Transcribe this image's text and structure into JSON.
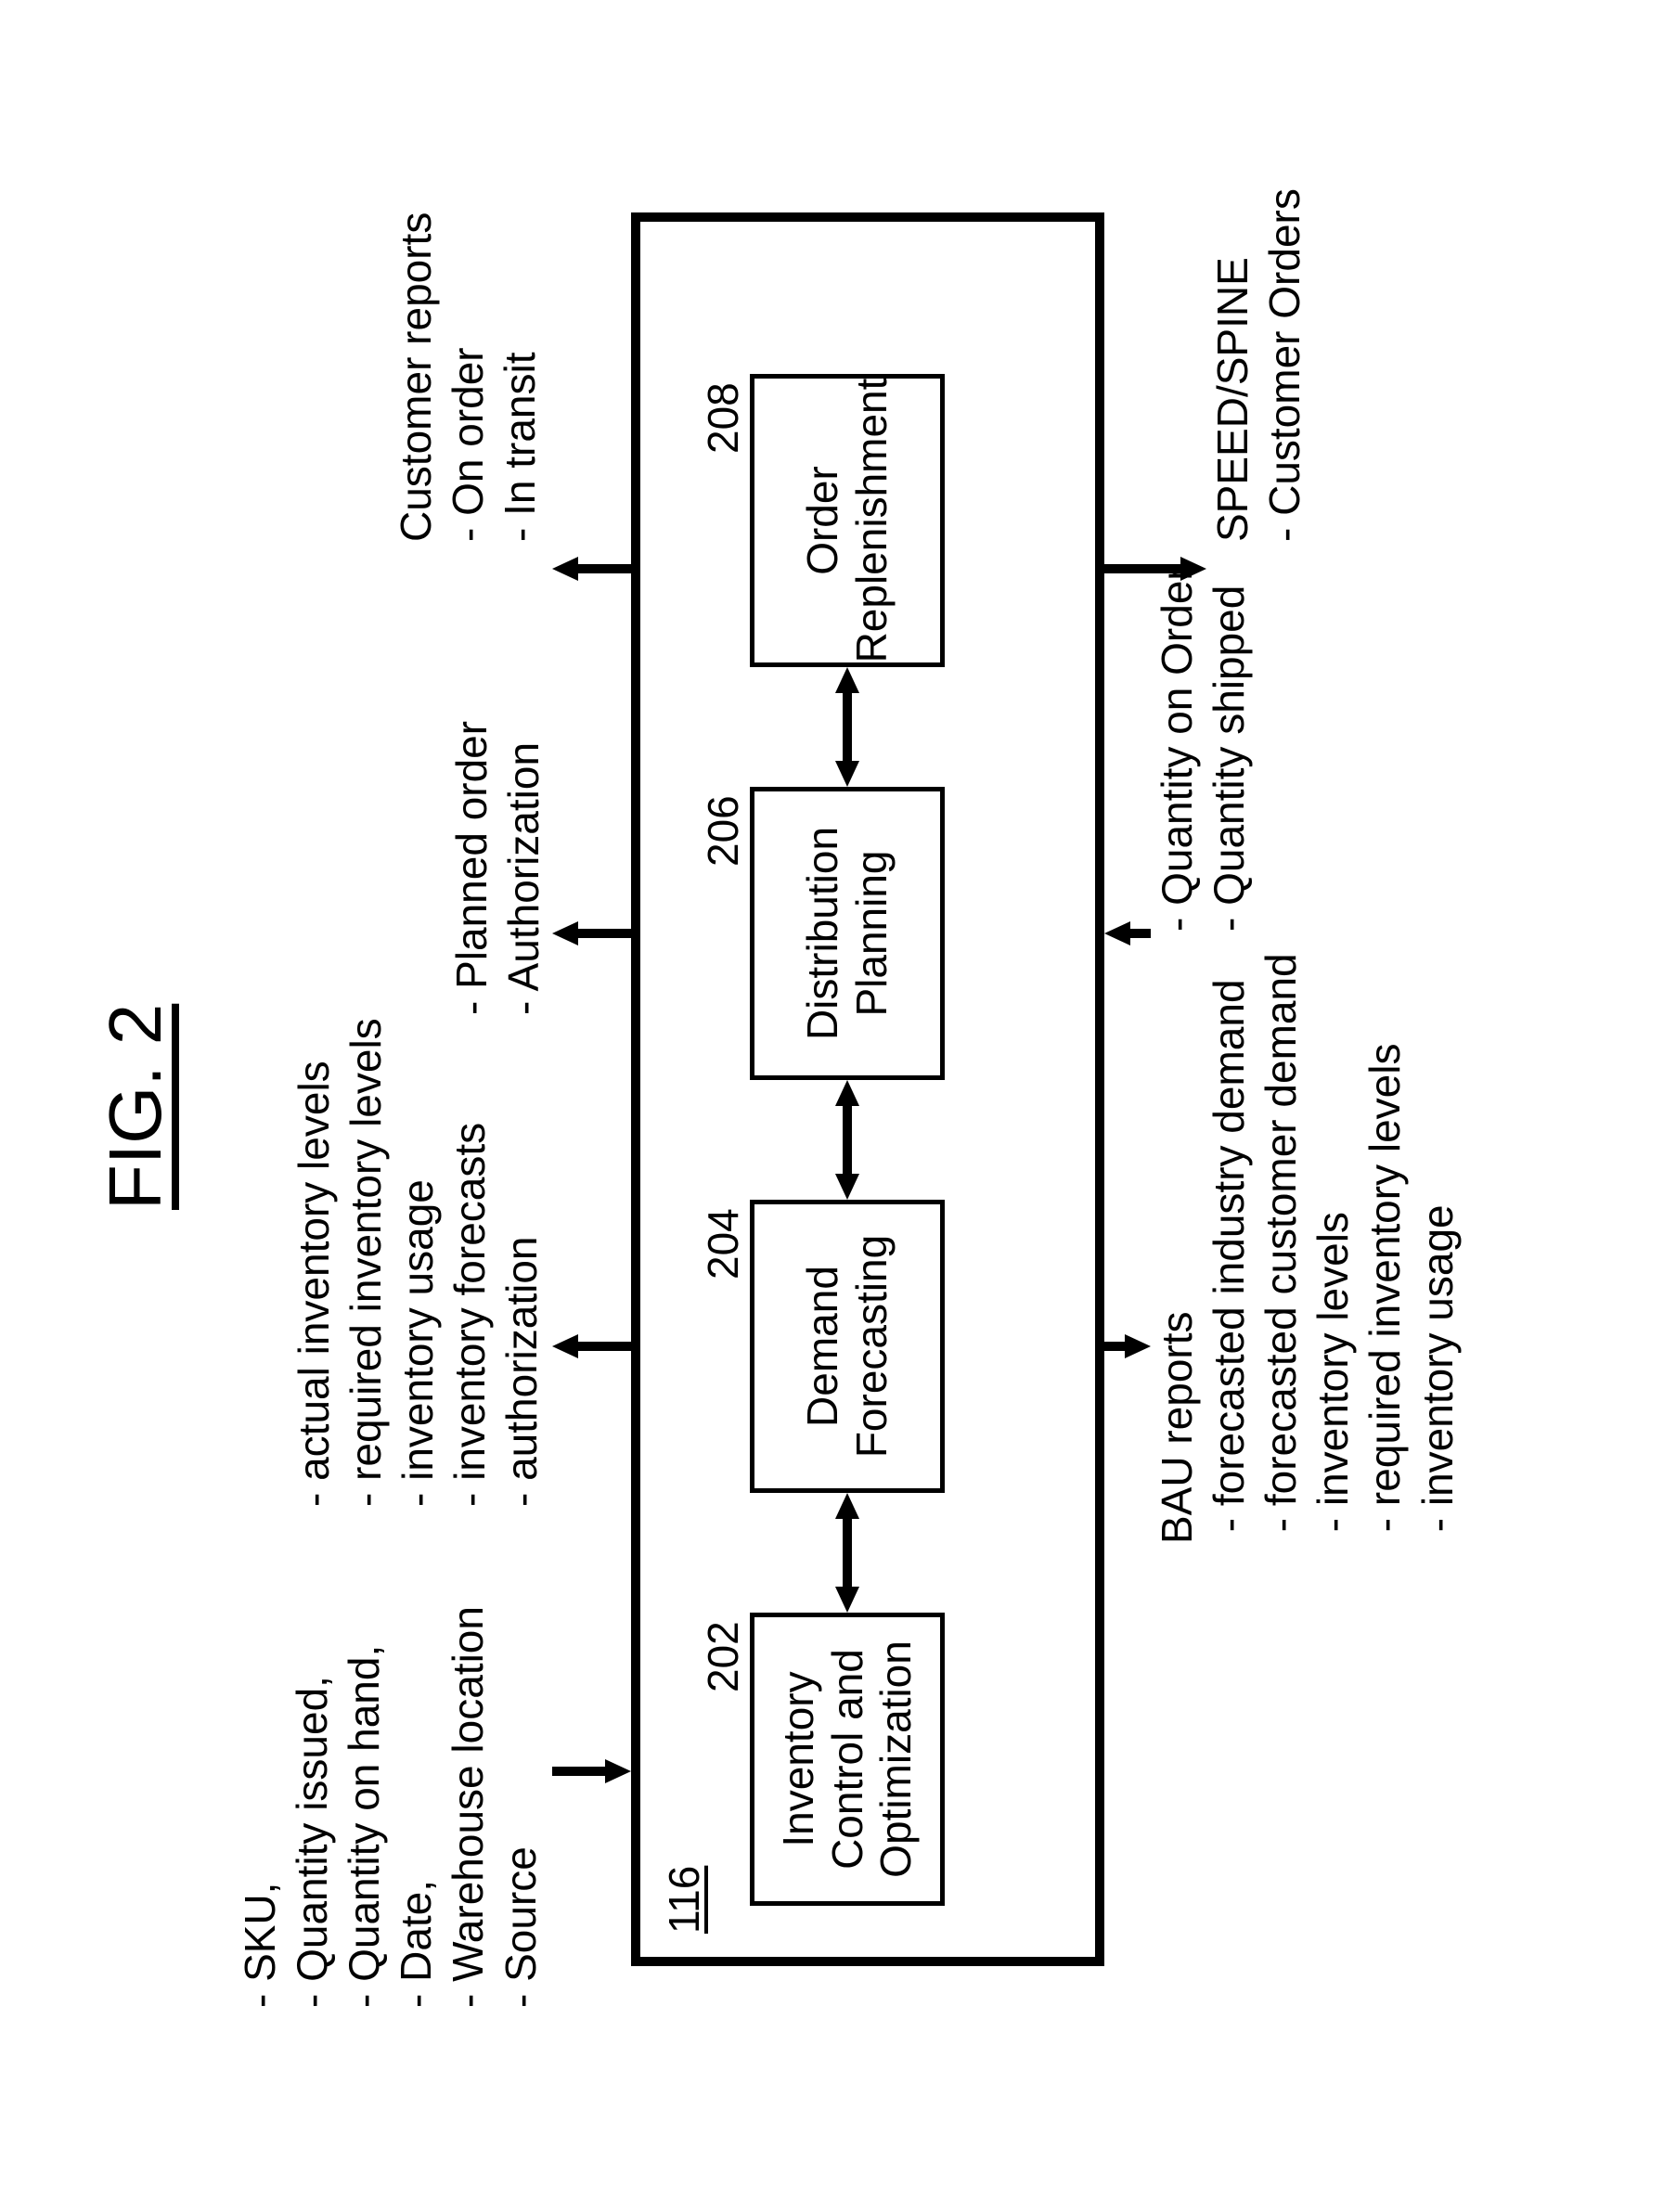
{
  "figure": {
    "title": "FIG. 2",
    "system_ref": "116"
  },
  "modules": {
    "inventory": {
      "label": "Inventory\nControl and\nOptimization",
      "ref": "202"
    },
    "demand": {
      "label": "Demand\nForecasting",
      "ref": "204"
    },
    "dist": {
      "label": "Distribution\nPlanning",
      "ref": "206"
    },
    "order": {
      "label": "Order\nReplenishment",
      "ref": "208"
    }
  },
  "notes": {
    "sku": "- SKU,\n- Quantity issued,\n- Quantity on hand,\n- Date,\n- Warehouse location\n- Source",
    "inv_levels": "- actual inventory levels\n- required inventory levels\n- inventory usage\n- inventory forecasts\n- authorization",
    "planned_order": "- Planned order\n- Authorization",
    "cust_reports": "Customer reports\n- On order\n- In transit",
    "bau": "BAU reports\n - forecasted industry demand\n - forecasted customer demand\n - inventory levels\n - required inventory levels\n - inventory usage",
    "qty_on_order": "- Quantity on Order\n- Quantity shipped",
    "speed": "SPEED/SPINE\n- Customer Orders"
  }
}
